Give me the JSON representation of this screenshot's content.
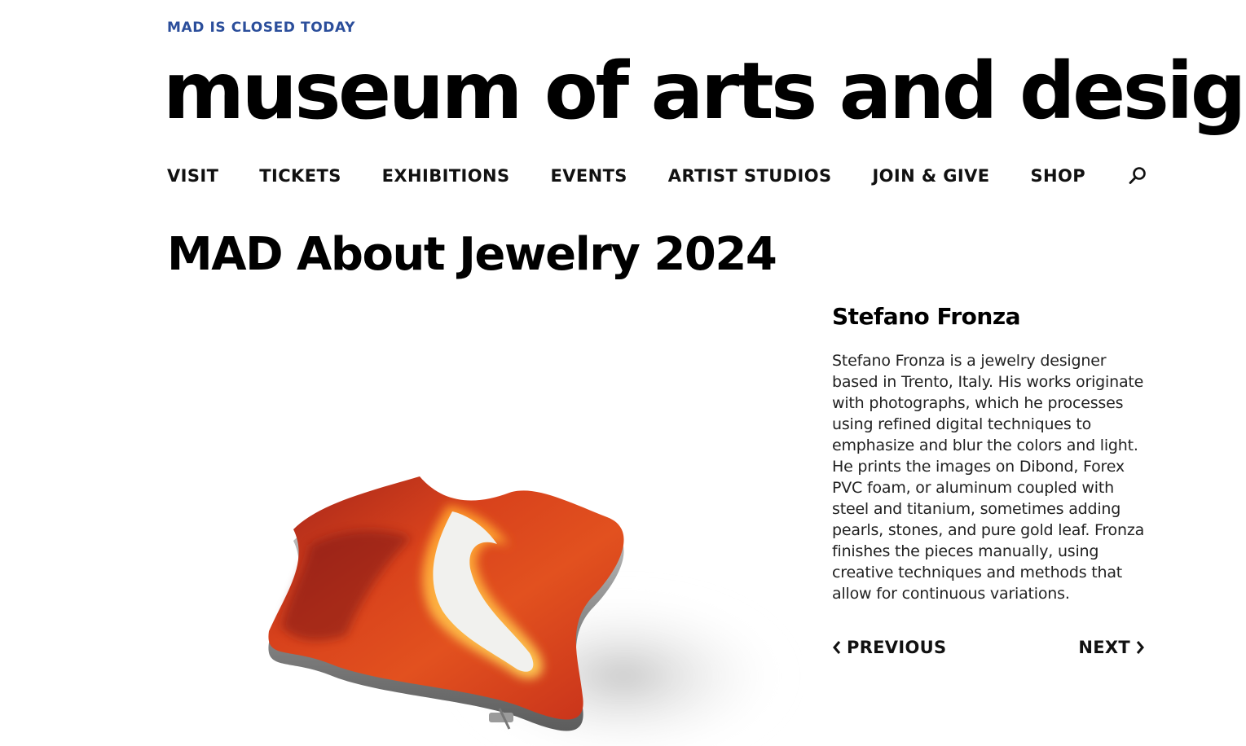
{
  "status": {
    "text": "MAD IS CLOSED TODAY",
    "color": "#2b4e9b"
  },
  "logo": {
    "text": "museum of arts and design"
  },
  "nav": {
    "items": [
      {
        "label": "VISIT"
      },
      {
        "label": "TICKETS"
      },
      {
        "label": "EXHIBITIONS"
      },
      {
        "label": "EVENTS"
      },
      {
        "label": "ARTIST STUDIOS"
      },
      {
        "label": "JOIN & GIVE"
      },
      {
        "label": "SHOP"
      }
    ],
    "search_icon": "search-icon"
  },
  "page": {
    "title": "MAD About Jewelry 2024"
  },
  "artist": {
    "name": "Stefano Fronza",
    "bio": "Stefano Fronza is a jewelry designer based in Trento, Italy. His works originate with photographs, which he processes using refined digital techniques to emphasize and blur the colors and light. He prints the images on Dibond, Forex PVC foam, or aluminum coupled with steel and titanium, sometimes adding pearls, stones, and pure gold leaf. Fronza finishes the pieces manually, using creative techniques and methods that allow for continuous variations."
  },
  "pager": {
    "previous_label": "PREVIOUS",
    "previous_icon": "chevron-left-icon",
    "next_label": "NEXT",
    "next_icon": "chevron-right-icon"
  }
}
